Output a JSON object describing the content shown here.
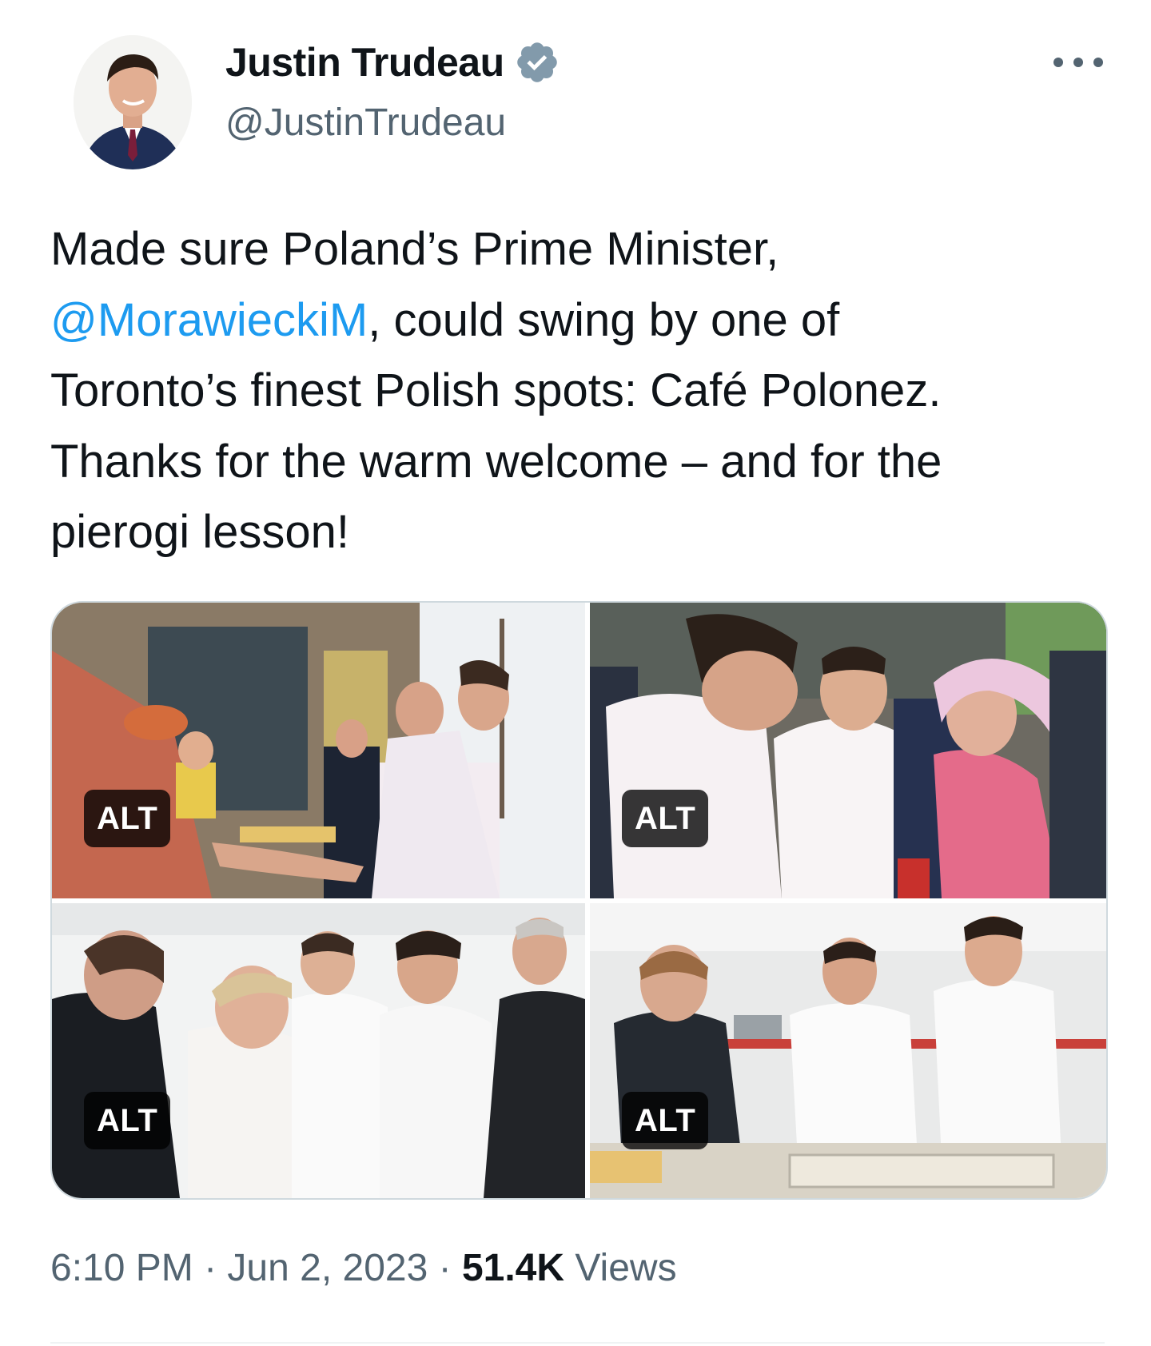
{
  "author": {
    "display_name": "Justin Trudeau",
    "handle": "@JustinTrudeau",
    "verified_icon": "verified-badge-icon",
    "verified_color": "#829aab"
  },
  "tweet": {
    "text_before_mention": "Made sure Poland’s Prime Minister,\n",
    "mention": "@MorawieckiM",
    "text_after_mention": ", could swing by one of\nToronto’s finest Polish spots: Café Polonez.\nThanks for the warm welcome – and for the\npierogi lesson!"
  },
  "media": {
    "alt_label": "ALT",
    "photos": [
      {
        "alt_badge": "ALT"
      },
      {
        "alt_badge": "ALT"
      },
      {
        "alt_badge": "ALT"
      },
      {
        "alt_badge": "ALT"
      }
    ]
  },
  "meta": {
    "time": "6:10 PM",
    "separator": " · ",
    "date": "Jun 2, 2023",
    "views_count": "51.4K",
    "views_label": "Views"
  },
  "colors": {
    "link": "#1d9bf0",
    "secondary_text": "#536471",
    "primary_text": "#0f1419",
    "border": "#cfd9de"
  },
  "icons": {
    "more": "more-horizontal-icon"
  }
}
